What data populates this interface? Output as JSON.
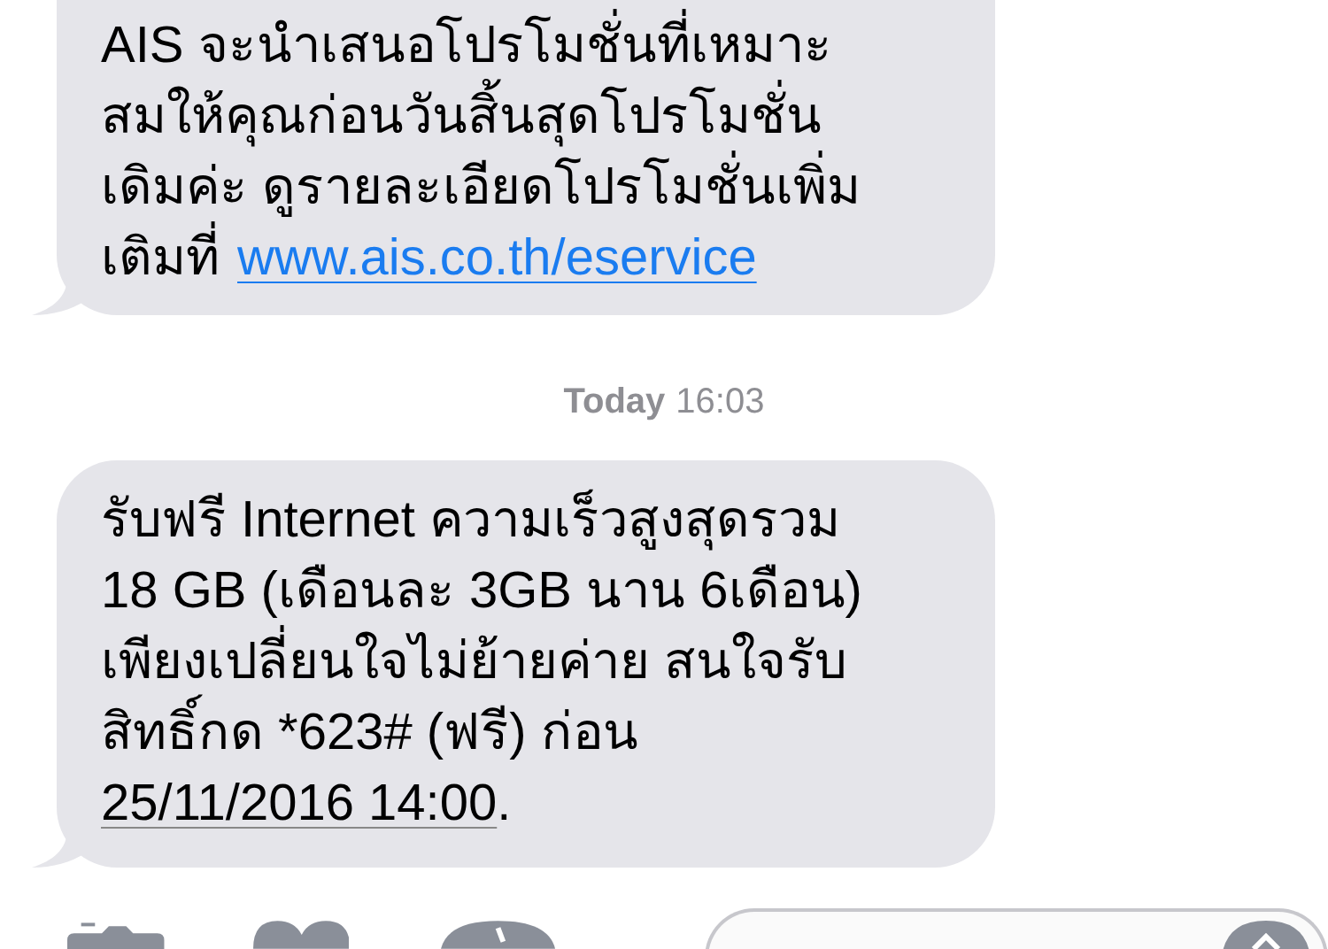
{
  "messages": [
    {
      "lines": [
        {
          "text": "AIS จะนำเสนอโปรโมชั่นที่เหมาะ"
        },
        {
          "text": "สมให้คุณก่อนวันสิ้นสุดโปรโมชั่น"
        },
        {
          "text": "เดิมค่ะ ดูรายละเอียดโปรโมชั่นเพิ่ม"
        },
        {
          "text": "เติมที่",
          "link": "www.ais.co.th/eservice"
        }
      ]
    },
    {
      "timestamp": {
        "day": "Today",
        "time": "16:03"
      },
      "lines": [
        {
          "text": "รับฟรี Internet ความเร็วสูงสุดรวม"
        },
        {
          "text": "18 GB (เดือนละ 3GB นาน 6เดือน)"
        },
        {
          "text": "เพียงเปลี่ยนใจไม่ย้ายค่าย สนใจรับ"
        },
        {
          "text": "สิทธิ์กด *623# (ฟรี) ก่อน"
        },
        {
          "date_link": "25/11/2016 14:00",
          "after": "."
        }
      ]
    }
  ]
}
